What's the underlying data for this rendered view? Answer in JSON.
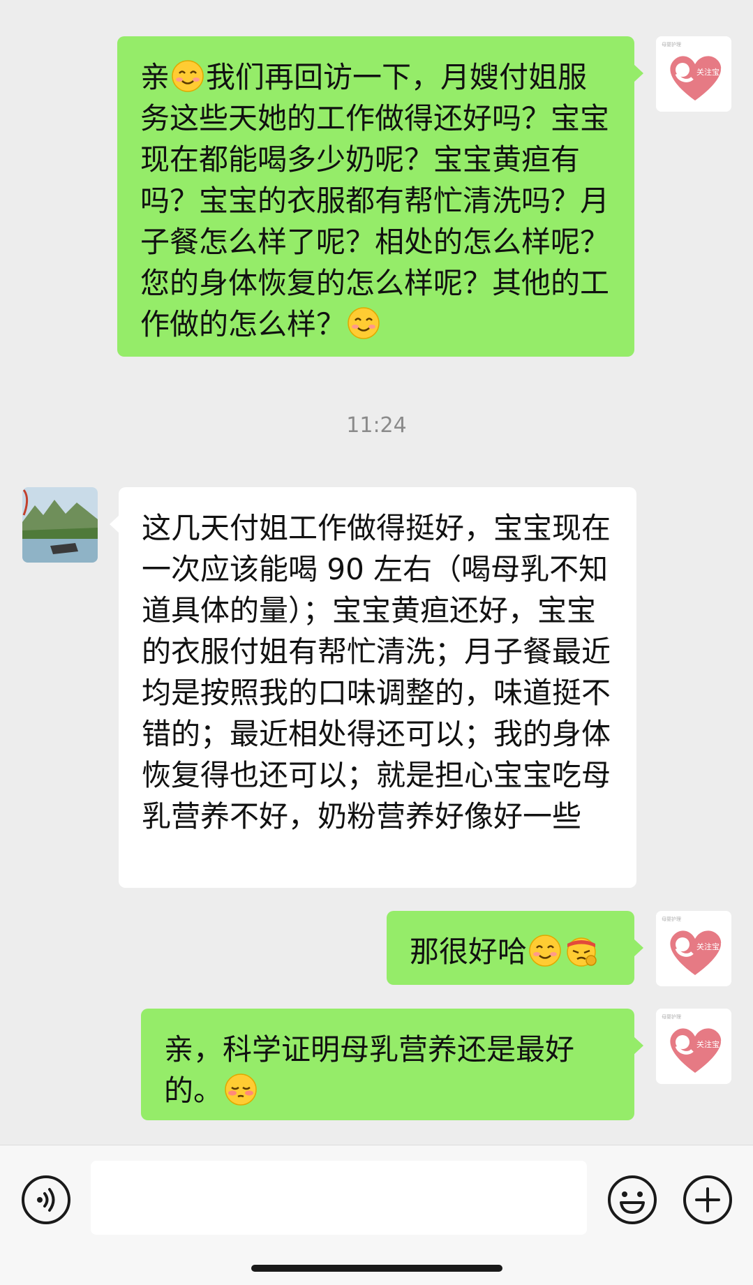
{
  "messages": [
    {
      "sender": "self",
      "parts": [
        {
          "text": "亲"
        },
        {
          "emoji": "smiling-face-icon"
        },
        {
          "text": "我们再回访一下，月嫂付姐服务这些天她的工作做得还好吗？宝宝现在都能喝多少奶呢？宝宝黄疸有吗？宝宝的衣服都有帮忙清洗吗？月子餐怎么样了呢？相处的怎么样呢？您的身体恢复的怎么样呢？其他的工作做的怎么样？"
        },
        {
          "emoji": "smiling-face-icon"
        }
      ]
    },
    {
      "sender": "other",
      "parts": [
        {
          "text": "这几天付姐工作做得挺好，宝宝现在一次应该能喝 90 左右（喝母乳不知道具体的量）；宝宝黄疸还好，宝宝的衣服付姐有帮忙清洗；月子餐最近均是按照我的口味调整的，味道挺不错的；最近相处得还可以；我的身体恢复得也还可以；就是担心宝宝吃母乳营养不好，奶粉营养好像好一些"
        }
      ]
    },
    {
      "sender": "self",
      "parts": [
        {
          "text": "那很好哈"
        },
        {
          "emoji": "smiling-face-icon"
        },
        {
          "emoji": "fighting-face-icon"
        }
      ]
    },
    {
      "sender": "self",
      "parts": [
        {
          "text": "亲，科学证明母乳营养还是最好的。"
        },
        {
          "emoji": "shy-face-icon"
        }
      ]
    }
  ],
  "timestamp": "11:24",
  "input": {
    "value": "",
    "placeholder": ""
  },
  "toolbar": {
    "voice_icon": "voice-icon",
    "emoji_icon": "emoji-icon",
    "plus_icon": "plus-icon"
  },
  "colors": {
    "background": "#ededed",
    "self_bubble": "#95ec69",
    "other_bubble": "#ffffff",
    "timestamp": "#8a8a8a"
  }
}
